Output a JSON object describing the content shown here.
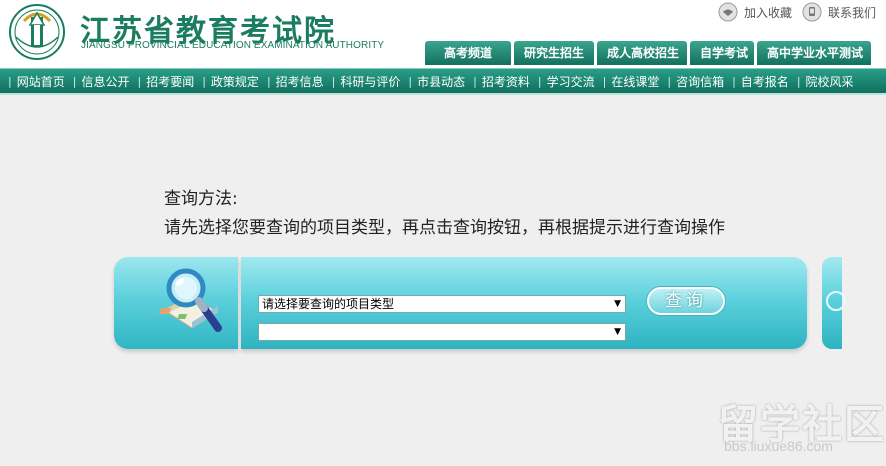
{
  "header": {
    "title_cn": "江苏省教育考试院",
    "title_en": "JIANGSU PROVINCIAL EDUCATION EXAMINATION AUTHORITY",
    "top_links": [
      {
        "label": "加入收藏",
        "icon": "bookmark-icon"
      },
      {
        "label": "联系我们",
        "icon": "contact-icon"
      }
    ],
    "channel_tabs": [
      "高考频道",
      "研究生招生",
      "成人高校招生",
      "自学考试",
      "高中学业水平测试"
    ]
  },
  "nav": {
    "items": [
      "网站首页",
      "信息公开",
      "招考要闻",
      "政策规定",
      "招考信息",
      "科研与评价",
      "市县动态",
      "招考资料",
      "学习交流",
      "在线课堂",
      "咨询信箱",
      "自考报名",
      "院校风采"
    ]
  },
  "instructions": {
    "title": "查询方法:",
    "text": "请先选择您要查询的项目类型，再点击查询按钮，再根据提示进行查询操作"
  },
  "query": {
    "select1_value": "请选择要查询的项目类型",
    "select2_value": "",
    "button_label": "查询",
    "icon": "magnifier-map-icon"
  },
  "watermark": {
    "text": "留学社区",
    "url": "bbs.liuxue86.com"
  },
  "colors": {
    "brand": "#1b7d5f",
    "nav": "#13705e",
    "panel": "#5dd1dd",
    "background": "#efefef"
  }
}
